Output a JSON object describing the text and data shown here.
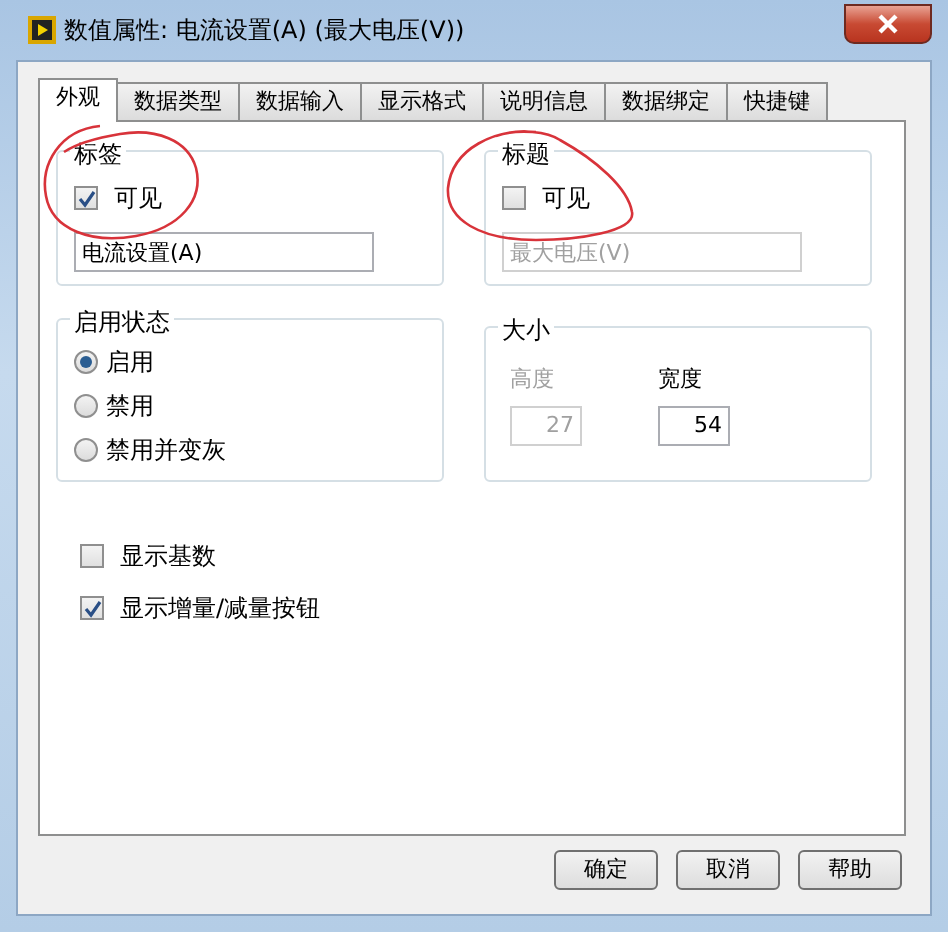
{
  "window": {
    "title": "数值属性: 电流设置(A) (最大电压(V))"
  },
  "tabs": [
    {
      "label": "外观",
      "selected": true
    },
    {
      "label": "数据类型",
      "selected": false
    },
    {
      "label": "数据输入",
      "selected": false
    },
    {
      "label": "显示格式",
      "selected": false
    },
    {
      "label": "说明信息",
      "selected": false
    },
    {
      "label": "数据绑定",
      "selected": false
    },
    {
      "label": "快捷键",
      "selected": false
    }
  ],
  "label_group": {
    "title": "标签",
    "visible": {
      "label": "可见",
      "checked": true
    },
    "field": {
      "value": "电流设置(A)",
      "disabled": false
    }
  },
  "caption_group": {
    "title": "标题",
    "visible": {
      "label": "可见",
      "checked": false
    },
    "field": {
      "value": "最大电压(V)",
      "disabled": true
    }
  },
  "enable_state": {
    "title": "启用状态",
    "options": [
      {
        "label": "启用",
        "selected": true
      },
      {
        "label": "禁用",
        "selected": false
      },
      {
        "label": "禁用并变灰",
        "selected": false
      }
    ]
  },
  "size": {
    "title": "大小",
    "fields": [
      {
        "label": "高度",
        "value": "27",
        "disabled": true
      },
      {
        "label": "宽度",
        "value": "54",
        "disabled": false
      }
    ]
  },
  "options": [
    {
      "label": "显示基数",
      "checked": false
    },
    {
      "label": "显示增量/减量按钮",
      "checked": true
    }
  ],
  "buttons": [
    {
      "label": "确定"
    },
    {
      "label": "取消"
    },
    {
      "label": "帮助"
    }
  ]
}
